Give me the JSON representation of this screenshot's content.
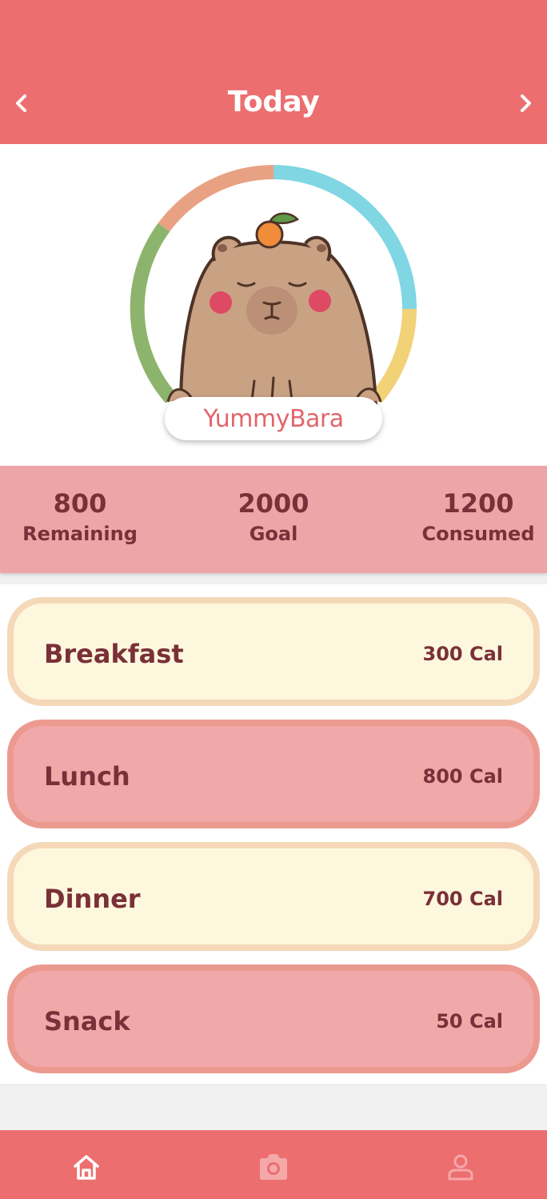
{
  "header": {
    "title": "Today",
    "prev_icon": "chevron-left-icon",
    "next_icon": "chevron-right-icon"
  },
  "mascot": {
    "name": "YummyBara"
  },
  "ring": {
    "segments": [
      {
        "name": "blue",
        "color": "#80d6e3"
      },
      {
        "name": "yellow",
        "color": "#f2d277"
      },
      {
        "name": "green",
        "color": "#8db46c"
      },
      {
        "name": "orange",
        "color": "#e8a283"
      }
    ]
  },
  "stats": {
    "remaining": {
      "value": "800",
      "label": "Remaining"
    },
    "goal": {
      "value": "2000",
      "label": "Goal"
    },
    "consumed": {
      "value": "1200",
      "label": "Consumed"
    }
  },
  "meals": [
    {
      "name": "Breakfast",
      "calories": "300 Cal"
    },
    {
      "name": "Lunch",
      "calories": "800 Cal"
    },
    {
      "name": "Dinner",
      "calories": "700 Cal"
    },
    {
      "name": "Snack",
      "calories": "50 Cal"
    }
  ],
  "tabbar": {
    "items": [
      {
        "icon": "home-icon",
        "active": true
      },
      {
        "icon": "camera-icon",
        "active": false
      },
      {
        "icon": "profile-icon",
        "active": false
      }
    ]
  },
  "colors": {
    "header": "#ec6e6f",
    "stats_bar": "#eda6a7",
    "text_dark": "#7a3038",
    "meal_light": "#fdf7dd",
    "meal_pink": "#f0a8a8"
  }
}
